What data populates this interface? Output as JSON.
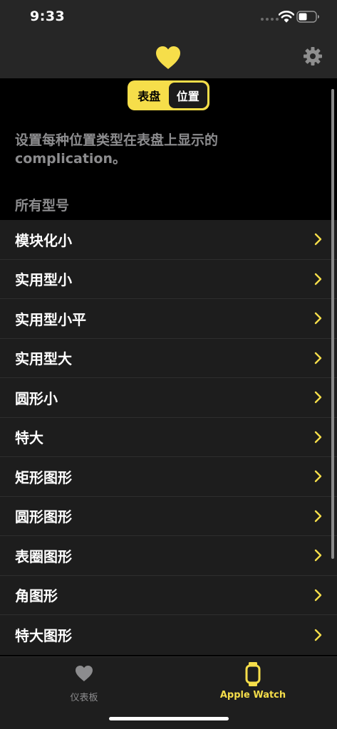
{
  "status_bar": {
    "time": "9:33"
  },
  "nav_bar": {
    "heart_icon": "heart-icon",
    "settings_icon": "gear-icon"
  },
  "segmented": {
    "faces_label": "表盘",
    "positions_label": "位置",
    "selected": "位置"
  },
  "description": "设置每种位置类型在表盘上显示的complication。",
  "section_header": "所有型号",
  "list": {
    "items": [
      {
        "label": "模块化小"
      },
      {
        "label": "实用型小"
      },
      {
        "label": "实用型小平"
      },
      {
        "label": "实用型大"
      },
      {
        "label": "圆形小"
      },
      {
        "label": "特大"
      },
      {
        "label": "矩形图形"
      },
      {
        "label": "圆形图形"
      },
      {
        "label": "表圈图形"
      },
      {
        "label": "角图形"
      },
      {
        "label": "特大图形"
      }
    ]
  },
  "tab_bar": {
    "tabs": [
      {
        "label": "仪表板",
        "icon": "heart-icon"
      },
      {
        "label": "Apple Watch",
        "icon": "watch-icon",
        "active": true
      }
    ]
  },
  "colors": {
    "accent": "#f6de4a",
    "background": "#000000",
    "bar": "#262626",
    "row": "#1d1d1d",
    "secondary_text": "#8c8c8e"
  }
}
